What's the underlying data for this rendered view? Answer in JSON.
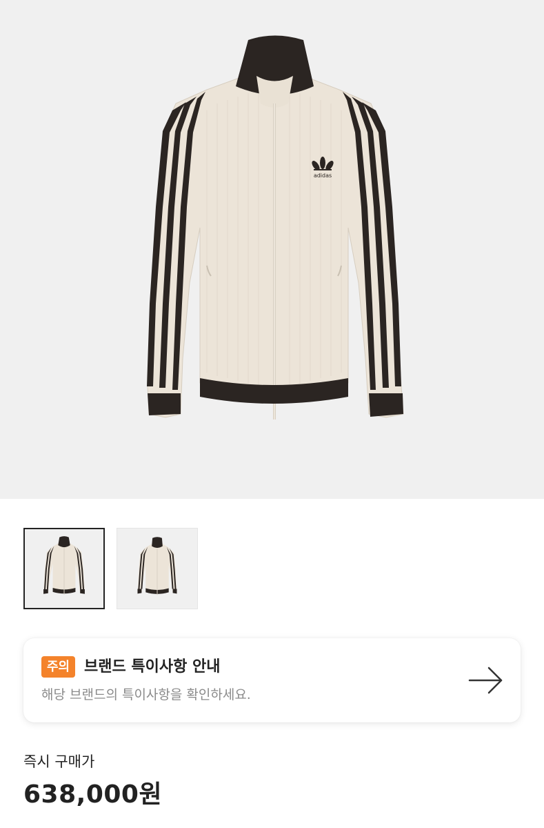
{
  "product": {
    "image_alt": "track-jacket",
    "logo_text": "adidas"
  },
  "gallery": {
    "thumbnails": [
      {
        "name": "thumb-1",
        "selected": true
      },
      {
        "name": "thumb-2",
        "selected": false
      }
    ]
  },
  "notice": {
    "badge": "주의",
    "title": "브랜드 특이사항 안내",
    "description": "해당 브랜드의 특이사항을 확인하세요.",
    "arrow_icon": "arrow-right-icon",
    "badge_color": "#f4832b"
  },
  "price": {
    "label": "즉시 구매가",
    "value": "638,000원"
  }
}
